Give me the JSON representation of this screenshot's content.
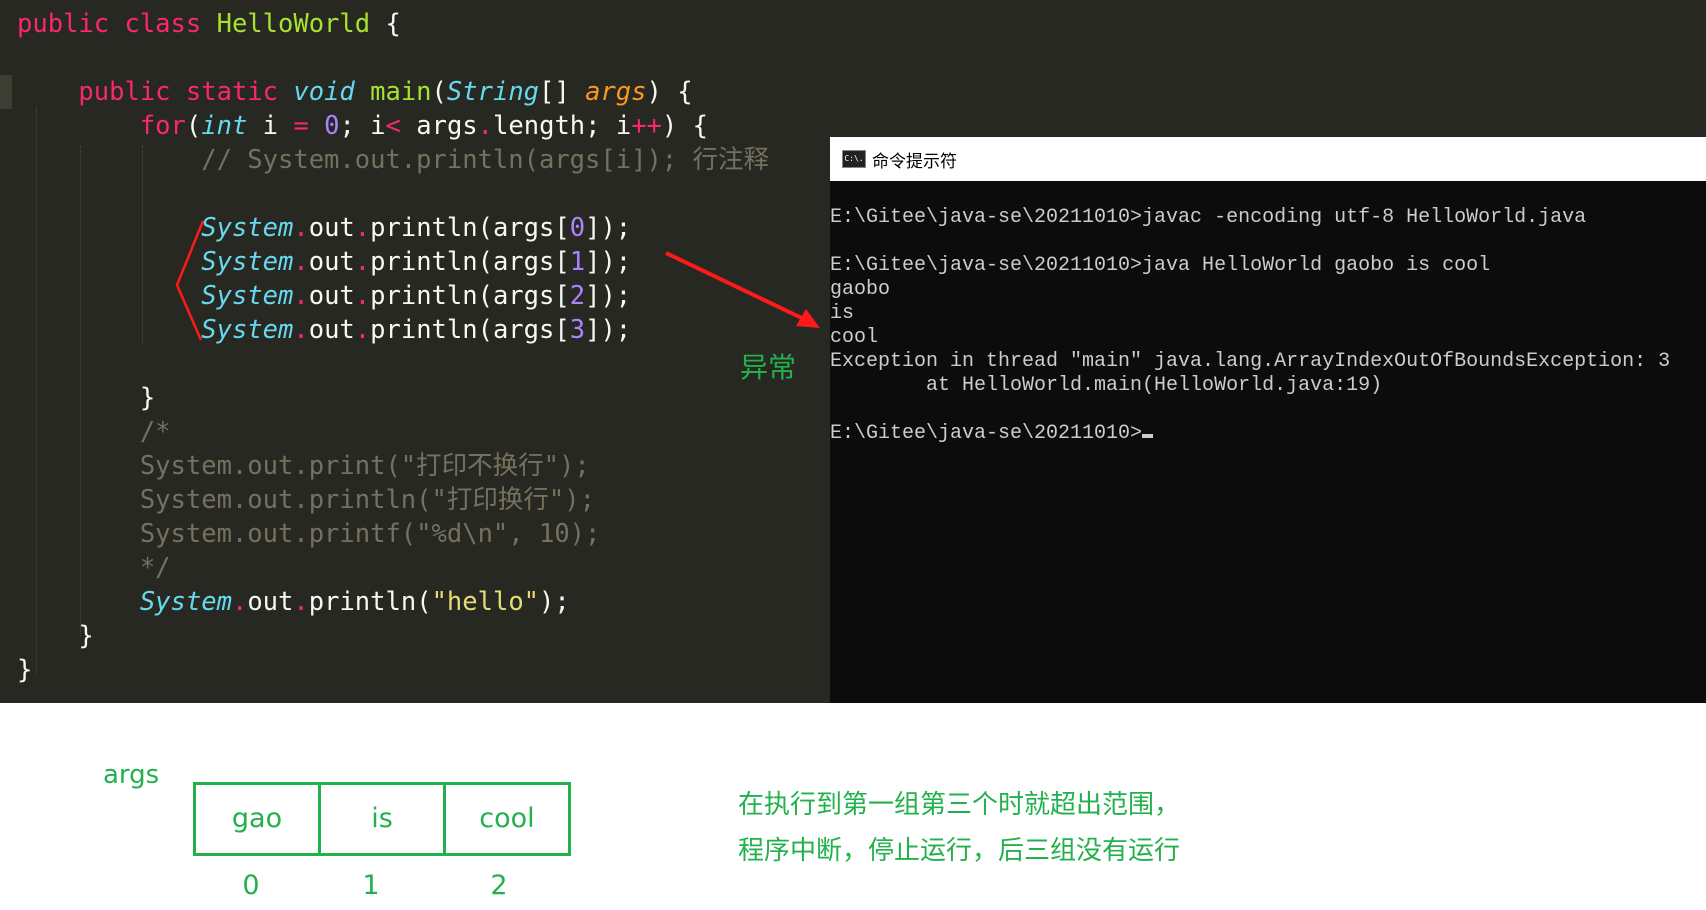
{
  "editor": {
    "lines": [
      [
        [
          "public ",
          "k"
        ],
        [
          "class ",
          "k"
        ],
        [
          "HelloWorld ",
          "f"
        ],
        [
          "{",
          "w"
        ]
      ],
      [],
      [
        [
          "    ",
          "w"
        ],
        [
          "public ",
          "k"
        ],
        [
          "static ",
          "k"
        ],
        [
          "void ",
          "t"
        ],
        [
          "main",
          "f"
        ],
        [
          "(",
          "w"
        ],
        [
          "String",
          "t"
        ],
        [
          "[] ",
          "w"
        ],
        [
          "args",
          "p"
        ],
        [
          ") {",
          "w"
        ]
      ],
      [
        [
          "        ",
          "w"
        ],
        [
          "for",
          "k"
        ],
        [
          "(",
          "w"
        ],
        [
          "int ",
          "t"
        ],
        [
          "i ",
          "w"
        ],
        [
          "= ",
          "o"
        ],
        [
          "0",
          "n"
        ],
        [
          "; i",
          "w"
        ],
        [
          "< ",
          "o"
        ],
        [
          "args",
          "w"
        ],
        [
          ".",
          "o"
        ],
        [
          "length; i",
          "w"
        ],
        [
          "++",
          "o"
        ],
        [
          ") {",
          "w"
        ]
      ],
      [
        [
          "            // System.out.println(args[i]); 行注释",
          "c"
        ]
      ],
      [],
      [
        [
          "            ",
          "w"
        ],
        [
          "System",
          "t"
        ],
        [
          ".",
          "o"
        ],
        [
          "out",
          "w"
        ],
        [
          ".",
          "o"
        ],
        [
          "println(args[",
          "w"
        ],
        [
          "0",
          "n"
        ],
        [
          "]);",
          "w"
        ]
      ],
      [
        [
          "            ",
          "w"
        ],
        [
          "System",
          "t"
        ],
        [
          ".",
          "o"
        ],
        [
          "out",
          "w"
        ],
        [
          ".",
          "o"
        ],
        [
          "println(args[",
          "w"
        ],
        [
          "1",
          "n"
        ],
        [
          "]);",
          "w"
        ]
      ],
      [
        [
          "            ",
          "w"
        ],
        [
          "System",
          "t"
        ],
        [
          ".",
          "o"
        ],
        [
          "out",
          "w"
        ],
        [
          ".",
          "o"
        ],
        [
          "println(args[",
          "w"
        ],
        [
          "2",
          "n"
        ],
        [
          "]);",
          "w"
        ]
      ],
      [
        [
          "            ",
          "w"
        ],
        [
          "System",
          "t"
        ],
        [
          ".",
          "o"
        ],
        [
          "out",
          "w"
        ],
        [
          ".",
          "o"
        ],
        [
          "println(args[",
          "w"
        ],
        [
          "3",
          "n"
        ],
        [
          "]);",
          "w"
        ]
      ],
      [],
      [
        [
          "        }",
          "w"
        ]
      ],
      [
        [
          "        /*",
          "c"
        ]
      ],
      [
        [
          "        System.out.print(\"打印不换行\");",
          "c"
        ]
      ],
      [
        [
          "        System.out.println(\"打印换行\");",
          "c"
        ]
      ],
      [
        [
          "        System.out.printf(\"%d\\n\", 10);",
          "c"
        ]
      ],
      [
        [
          "        */",
          "c"
        ]
      ],
      [
        [
          "        ",
          "w"
        ],
        [
          "System",
          "t"
        ],
        [
          ".",
          "o"
        ],
        [
          "out",
          "w"
        ],
        [
          ".",
          "o"
        ],
        [
          "println(",
          "w"
        ],
        [
          "\"hello\"",
          "s"
        ],
        [
          ");",
          "w"
        ]
      ],
      [
        [
          "    }",
          "w"
        ]
      ],
      [
        [
          "}",
          "w"
        ]
      ]
    ],
    "annotation": "异常"
  },
  "terminal": {
    "title": "命令提示符",
    "icon": "cmd-icon",
    "icon_text": "C:\\.",
    "lines": [
      "E:\\Gitee\\java-se\\20211010>javac -encoding utf-8 HelloWorld.java",
      "",
      "E:\\Gitee\\java-se\\20211010>java HelloWorld gaobo is cool",
      "gaobo",
      "is",
      "cool",
      "Exception in thread \"main\" java.lang.ArrayIndexOutOfBoundsException: 3",
      "        at HelloWorld.main(HelloWorld.java:19)",
      ""
    ],
    "prompt": "E:\\Gitee\\java-se\\20211010>"
  },
  "diagram": {
    "label": "args",
    "cells": [
      "gao",
      "is",
      "cool"
    ],
    "indices": [
      "0",
      "1",
      "2"
    ],
    "note_lines": [
      "在执行到第一组第三个时就超出范围，",
      "程序中断，停止运行，后三组没有运行"
    ]
  },
  "colors": {
    "annotation": "#22b14c",
    "marker": "#ff1a1a",
    "background": "#272822"
  }
}
